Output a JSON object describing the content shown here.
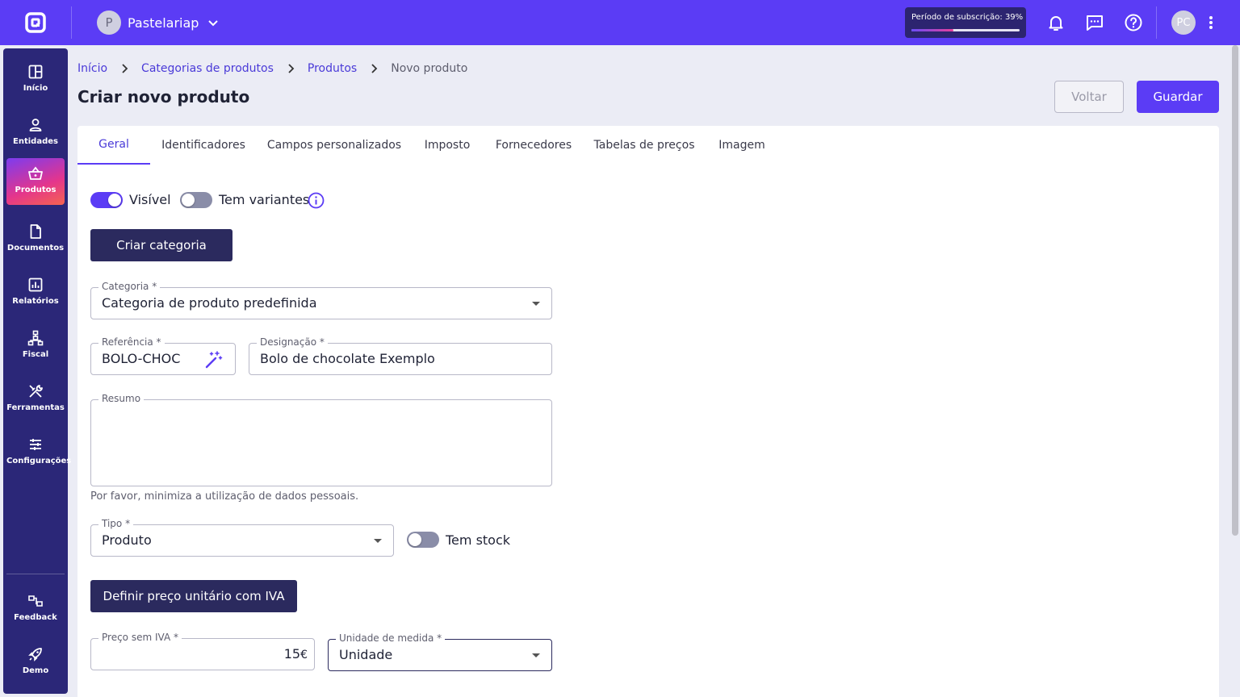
{
  "header": {
    "company_initial": "P",
    "company_name": "Pastelariap",
    "subscription_label": "Período de subscrição: 39%",
    "subscription_progress": 0.39,
    "user_initials": "PC",
    "accent_color": "#5b3cf5"
  },
  "sidebar": {
    "items": [
      {
        "label": "Início",
        "icon": "dashboard-icon"
      },
      {
        "label": "Entidades",
        "icon": "person-icon"
      },
      {
        "label": "Produtos",
        "icon": "basket-icon",
        "active": true
      },
      {
        "label": "Documentos",
        "icon": "document-icon"
      },
      {
        "label": "Relatórios",
        "icon": "chart-icon"
      },
      {
        "label": "Fiscal",
        "icon": "hierarchy-icon"
      },
      {
        "label": "Ferramentas",
        "icon": "tools-icon"
      },
      {
        "label": "Configurações",
        "icon": "sliders-icon"
      }
    ],
    "bottom": [
      {
        "label": "Feedback",
        "icon": "feedback-icon"
      },
      {
        "label": "Demo",
        "icon": "rocket-icon"
      }
    ]
  },
  "breadcrumb": {
    "items": [
      "Início",
      "Categorias de produtos",
      "Produtos"
    ],
    "current": "Novo produto"
  },
  "page": {
    "title": "Criar novo produto",
    "back_label": "Voltar",
    "save_label": "Guardar"
  },
  "tabs": [
    "Geral",
    "Identificadores",
    "Campos personalizados",
    "Imposto",
    "Fornecedores",
    "Tabelas de preços",
    "Imagem"
  ],
  "form": {
    "visible_label": "Visível",
    "visible_on": true,
    "variants_label": "Tem variantes",
    "variants_on": false,
    "create_category_label": "Criar categoria",
    "category": {
      "label": "Categoria *",
      "value": "Categoria de produto predefinida"
    },
    "reference": {
      "label": "Referência *",
      "value": "BOLO-CHOC"
    },
    "designation": {
      "label": "Designação *",
      "value": "Bolo de chocolate Exemplo"
    },
    "summary": {
      "label": "Resumo",
      "value": "",
      "helper": "Por favor, minimiza a utilização de dados pessoais."
    },
    "type": {
      "label": "Tipo *",
      "value": "Produto"
    },
    "stock_label": "Tem stock",
    "stock_on": false,
    "set_price_label": "Definir preço unitário com IVA",
    "price": {
      "label": "Preço sem IVA *",
      "value": "15",
      "currency": "€"
    },
    "unit": {
      "label": "Unidade de medida *",
      "value": "Unidade"
    }
  }
}
